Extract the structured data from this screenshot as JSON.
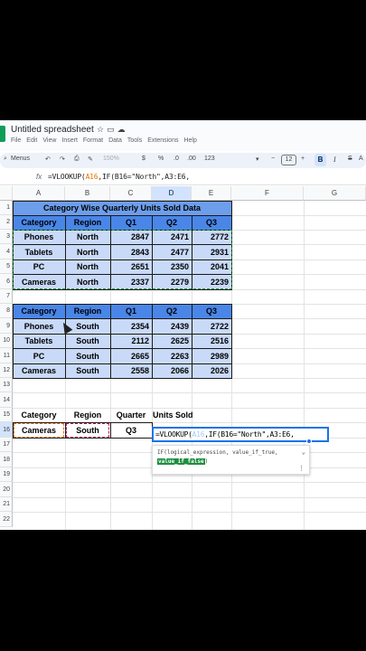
{
  "app": {
    "title": "Untitled spreadsheet",
    "menus": [
      "File",
      "Edit",
      "View",
      "Insert",
      "Format",
      "Data",
      "Tools",
      "Extensions",
      "Help"
    ]
  },
  "toolbar": {
    "menus_label": "Menus",
    "zoom": "150%",
    "currency": "$",
    "percent": "%",
    "decrease_decimal": ".0",
    "increase_decimal": ".00",
    "number_format": "123",
    "font_size": "12",
    "bold": "B",
    "italic": "I"
  },
  "formula_bar": {
    "fx": "fx",
    "prefix": "=VLOOKUP(",
    "ref1": "A16",
    "middle": ",IF(B16=\"North\",",
    "ref2": "A3:E6",
    "suffix": ","
  },
  "columns": [
    "A",
    "B",
    "C",
    "D",
    "E",
    "F",
    "G"
  ],
  "rows": [
    "1",
    "2",
    "3",
    "4",
    "5",
    "6",
    "7",
    "8",
    "9",
    "10",
    "11",
    "12",
    "13",
    "14",
    "15",
    "16",
    "17",
    "18",
    "19",
    "20",
    "21",
    "22"
  ],
  "table1": {
    "title": "Category Wise Quarterly Units Sold Data",
    "headers": [
      "Category",
      "Region",
      "Q1",
      "Q2",
      "Q3"
    ],
    "rows": [
      [
        "Phones",
        "North",
        "2847",
        "2471",
        "2772"
      ],
      [
        "Tablets",
        "North",
        "2843",
        "2477",
        "2931"
      ],
      [
        "PC",
        "North",
        "2651",
        "2350",
        "2041"
      ],
      [
        "Cameras",
        "North",
        "2337",
        "2279",
        "2239"
      ]
    ]
  },
  "table2": {
    "headers": [
      "Category",
      "Region",
      "Q1",
      "Q2",
      "Q3"
    ],
    "rows": [
      [
        "Phones",
        "South",
        "2354",
        "2439",
        "2722"
      ],
      [
        "Tablets",
        "South",
        "2112",
        "2625",
        "2516"
      ],
      [
        "PC",
        "South",
        "2665",
        "2263",
        "2989"
      ],
      [
        "Cameras",
        "South",
        "2558",
        "2066",
        "2026"
      ]
    ]
  },
  "lookup": {
    "headers": [
      "Category",
      "Region",
      "Quarter",
      "Units Sold"
    ],
    "values": [
      "Cameras",
      "South",
      "Q3"
    ]
  },
  "edit_cell": {
    "prefix": "=VLOOKUP(",
    "ref1": "A16",
    "middle": ",IF(B16=\"North\",",
    "ref2": "A3:E6",
    "suffix": ","
  },
  "tooltip": {
    "signature": "IF(logical_expression, value_if_true,",
    "active_arg": "value_if_false",
    "close": ")"
  },
  "colors": {
    "header_blue": "#4a86e8",
    "title_blue": "#6d9eeb",
    "data_blue": "#c9daf8",
    "selection": "#1a73e8",
    "range_orange": "#e37400"
  }
}
